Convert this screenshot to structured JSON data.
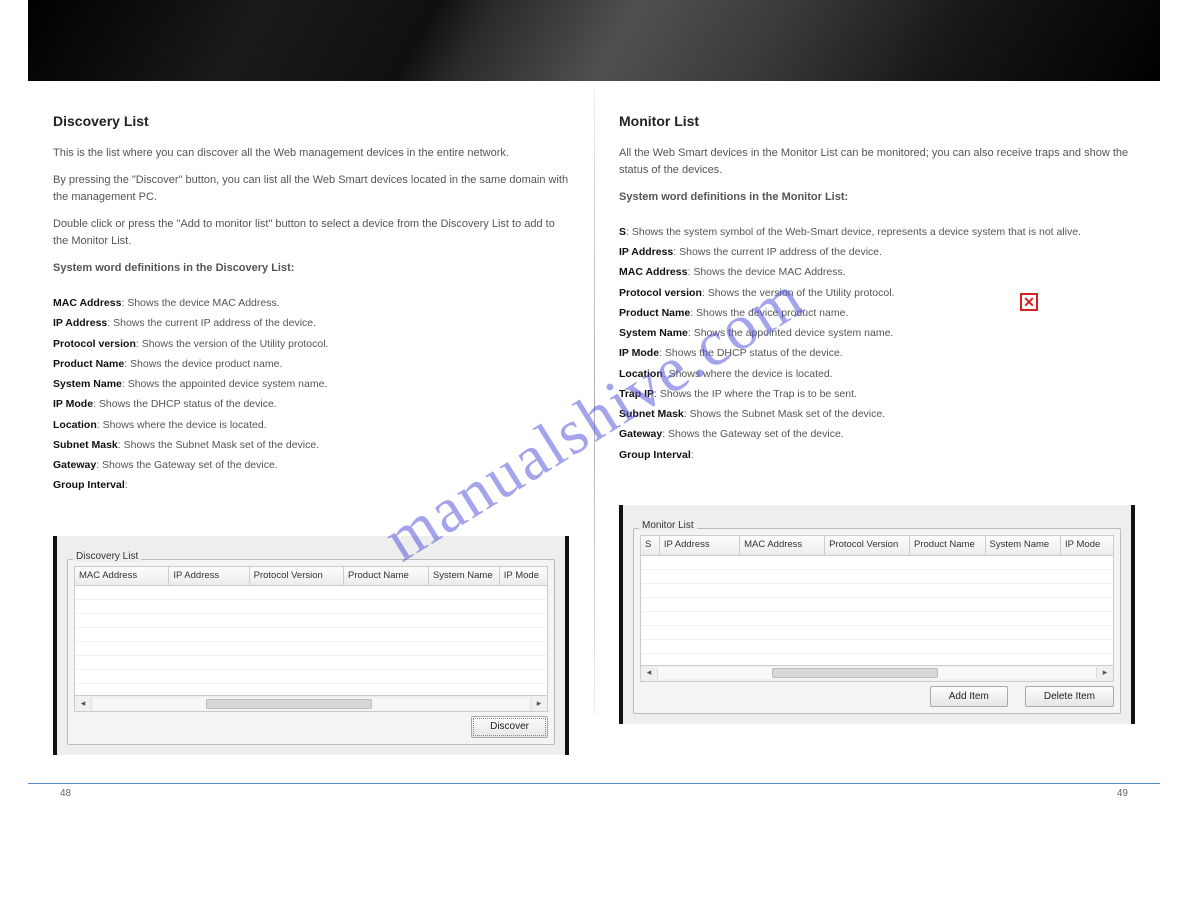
{
  "watermark": "manualshive.com",
  "red_x": "✕",
  "left": {
    "title": "Discovery List",
    "intro": "This is the list where you can discover all the Web management devices in the entire network.",
    "instruction": "By pressing the \"Discover\" button, you can list all the Web Smart devices located in the same domain with the management PC.",
    "instruction2": "Double click or press the \"Add to monitor list\" button to select a device from the Discovery List to add to the Monitor List.",
    "defs_title": "System word definitions in the Discovery List:",
    "fields": [
      {
        "k": "MAC Address",
        "v": "Shows the device MAC Address."
      },
      {
        "k": "IP Address",
        "v": "Shows the current IP address of the device."
      },
      {
        "k": "Protocol version",
        "v": "Shows the version of the Utility protocol."
      },
      {
        "k": "Product Name",
        "v": "Shows the device product name."
      },
      {
        "k": "System Name",
        "v": "Shows the appointed device system name."
      },
      {
        "k": "IP Mode",
        "v": "Shows the DHCP status of the device."
      },
      {
        "k": "Location",
        "v": "Shows where the device is located."
      },
      {
        "k": "Subnet Mask",
        "v": "Shows the Subnet Mask set of the device."
      },
      {
        "k": "Gateway",
        "v": "Shows the Gateway set of the device."
      },
      {
        "k": "Group Interval",
        "v": ""
      }
    ],
    "columns": [
      "MAC Address",
      "IP Address",
      "Protocol Version",
      "Product Name",
      "System Name",
      "IP Mode"
    ],
    "panel_label": "Discovery List",
    "buttons": {
      "discover": "Discover"
    }
  },
  "right": {
    "title": "Monitor List",
    "intro": "All the Web Smart devices in the Monitor List can be monitored; you can also receive traps and show the status of the devices.",
    "defs_title": "System word definitions in the Monitor List:",
    "fields": [
      {
        "k": "S",
        "v": "Shows the system symbol of the Web-Smart device,     represents a device system that is not alive."
      },
      {
        "k": "IP Address",
        "v": "Shows the current IP address of the device."
      },
      {
        "k": "MAC Address",
        "v": "Shows the device MAC Address."
      },
      {
        "k": "Protocol version",
        "v": "Shows the version of the Utility protocol."
      },
      {
        "k": "Product Name",
        "v": "Shows the device product name."
      },
      {
        "k": "System Name",
        "v": "Shows the appointed device system name."
      },
      {
        "k": "IP Mode",
        "v": "Shows the DHCP status of the device."
      },
      {
        "k": "Location",
        "v": "Shows where the device is located."
      },
      {
        "k": "Trap IP",
        "v": "Shows the IP where the Trap is to be sent."
      },
      {
        "k": "Subnet Mask",
        "v": "Shows the Subnet Mask set of the device."
      },
      {
        "k": "Gateway",
        "v": "Shows the Gateway set of the device."
      },
      {
        "k": "Group Interval",
        "v": ""
      }
    ],
    "columns": [
      "S",
      "IP Address",
      "MAC Address",
      "Protocol Version",
      "Product Name",
      "System Name",
      "IP Mode"
    ],
    "panel_label": "Monitor List",
    "buttons": {
      "add": "Add Item",
      "del": "Delete Item"
    }
  },
  "pages": {
    "left": "48",
    "right": "49"
  }
}
